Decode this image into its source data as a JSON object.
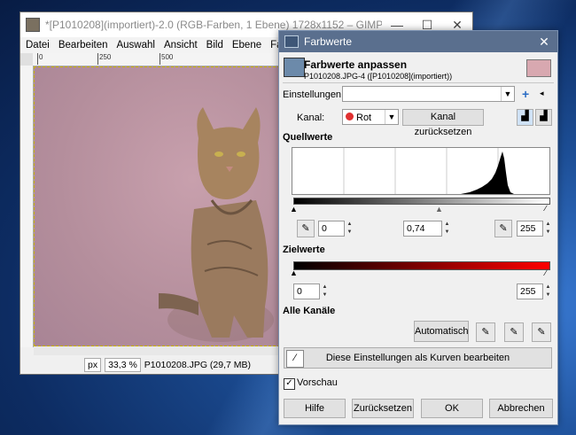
{
  "gimp_window": {
    "title": "*[P1010208](importiert)-2.0 (RGB-Farben, 1 Ebene) 1728x1152 – GIMP",
    "controls": [
      "—",
      "☐",
      "✕"
    ],
    "menu": [
      "Datei",
      "Bearbeiten",
      "Auswahl",
      "Ansicht",
      "Bild",
      "Ebene",
      "Farben"
    ],
    "ruler_ticks": [
      "0",
      "250",
      "500"
    ],
    "status": {
      "unit": "px",
      "zoom": "33,3 %",
      "file": "P1010208.JPG (29,7 MB)"
    }
  },
  "dialog": {
    "title": "Farbwerte",
    "close": "✕",
    "heading": "Farbwerte anpassen",
    "subheading": "P1010208.JPG-4 ([P1010208](importiert))",
    "settings_label": "Einstellungen:",
    "settings_value": "",
    "channel_label": "Kanal:",
    "channel_value": "Rot",
    "reset_channel": "Kanal zurücksetzen",
    "source_section": "Quellwerte",
    "source_low": "0",
    "source_gamma": "0,74",
    "source_high": "255",
    "target_section": "Zielwerte",
    "target_low": "0",
    "target_high": "255",
    "all_channels_section": "Alle Kanäle",
    "auto_button": "Automatisch",
    "curves_button": "Diese Einstellungen als Kurven bearbeiten",
    "preview_label": "Vorschau",
    "preview_checked": true,
    "buttons": {
      "help": "Hilfe",
      "reset": "Zurücksetzen",
      "ok": "OK",
      "cancel": "Abbrechen"
    }
  },
  "colors": {
    "title_bar": "#5a6f8e",
    "accent": "#ff0000"
  }
}
